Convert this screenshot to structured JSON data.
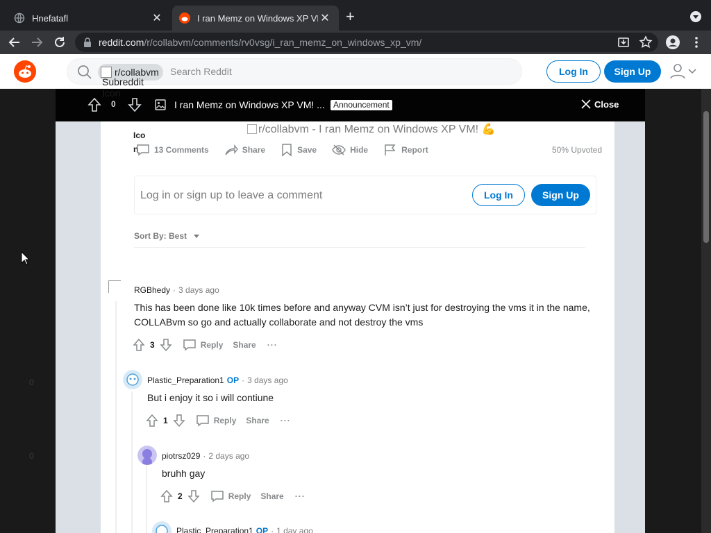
{
  "browser": {
    "tabs": [
      {
        "title": "Hnefatafl",
        "active": false
      },
      {
        "title": "I ran Memz on Windows XP VM!",
        "active": true
      }
    ],
    "url_host": "reddit.com",
    "url_path": "/r/collabvm/comments/rv0vsg/i_ran_memz_on_windows_xp_vm/",
    "new_tab": "+"
  },
  "header": {
    "subreddit_chip": "r/collabvm",
    "subreddit_alt": "Subreddit Icon",
    "search_placeholder": "Search Reddit",
    "login_label": "Log In",
    "signup_label": "Sign Up"
  },
  "post_bar": {
    "votes": "0",
    "title": "I ran Memz on Windows XP VM! ...",
    "flair": "Announcement",
    "close_label": "Close"
  },
  "post": {
    "subicon_alt_lines": [
      "Ico",
      "n"
    ],
    "image_alt": "r/collabvm - I ran Memz on Windows XP VM! 💪",
    "actions": {
      "comments": "13 Comments",
      "share": "Share",
      "save": "Save",
      "hide": "Hide",
      "report": "Report"
    },
    "upvoted": "50% Upvoted"
  },
  "comment_box": {
    "prompt": "Log in or sign up to leave a comment",
    "login_label": "Log In",
    "signup_label": "Sign Up"
  },
  "sort_label": "Sort By: Best",
  "comments": [
    {
      "author": "RGBhedy",
      "op": "",
      "time": "3 days ago",
      "body": "This has been done like 10k times before and anyway CVM isn’t just for destroying the vms it in the name, COLLABvm so go and actually collaborate and not destroy the vms",
      "score": "3"
    },
    {
      "author": "Plastic_Preparation1",
      "op": "OP",
      "time": "3 days ago",
      "body": "But i enjoy it so i will contiune",
      "score": "1"
    },
    {
      "author": "piotrsz029",
      "op": "",
      "time": "2 days ago",
      "body": "bruhh gay",
      "score": "2"
    },
    {
      "author": "Plastic_Preparation1",
      "op": "OP",
      "time": "1 day ago",
      "body": "",
      "score": ""
    }
  ],
  "comment_action_labels": {
    "reply": "Reply",
    "share": "Share",
    "more": "···"
  },
  "background_faint": [
    "0",
    "0"
  ],
  "colors": {
    "reddit_blue": "#0079d3",
    "reddit_orange": "#ff4500",
    "chrome_dark": "#202124"
  }
}
